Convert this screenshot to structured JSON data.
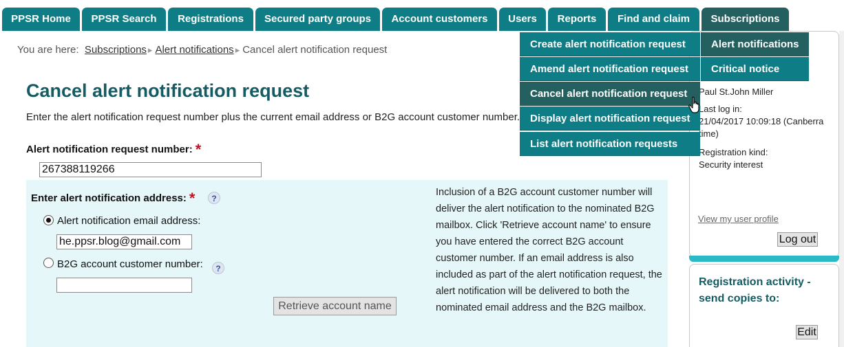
{
  "nav": {
    "tabs": [
      {
        "label": "PPSR Home"
      },
      {
        "label": "PPSR Search"
      },
      {
        "label": "Registrations"
      },
      {
        "label": "Secured party groups"
      },
      {
        "label": "Account customers"
      },
      {
        "label": "Users"
      },
      {
        "label": "Reports"
      },
      {
        "label": "Find and claim"
      },
      {
        "label": "Subscriptions",
        "active": true
      }
    ]
  },
  "breadcrumb": {
    "prefix": "You are here:",
    "items": [
      "Subscriptions",
      "Alert notifications"
    ],
    "current": "Cancel alert notification request"
  },
  "main": {
    "title": "Cancel alert notification request",
    "intro": "Enter the alert notification request number plus the current email address or B2G account customer number.",
    "request_number": {
      "label": "Alert notification request number:",
      "required_mark": "*",
      "value": "267388119266"
    },
    "address": {
      "label": "Enter alert notification address:",
      "required_mark": "*",
      "help": "?",
      "email_option": {
        "label": "Alert notification email address:",
        "selected": true,
        "value": "he.ppsr.blog@gmail.com"
      },
      "b2g_option": {
        "label": "B2G account customer number:",
        "selected": false,
        "value": "",
        "help": "?"
      },
      "retrieve_button": "Retrieve account name",
      "info": "Inclusion of a B2G account customer number will deliver the alert notification to the nominated B2G mailbox. Click 'Retrieve account name' to ensure you have entered the correct B2G account customer number. If an email address is also included as part of the alert notification request, the alert notification will be delivered to both the nominated email address and the B2G mailbox."
    }
  },
  "sidebar": {
    "user_name": "Paul St.John Miller",
    "last_login_label": "Last log in:",
    "last_login_value": "21/04/2017 10:09:18 (Canberra time)",
    "registration_kind_label": "Registration kind:",
    "registration_kind_value": "Security interest",
    "profile_link": "View my user profile",
    "logout_button": "Log out",
    "activity_heading": "Registration activity - send copies to:",
    "edit_button": "Edit"
  },
  "menus": {
    "subscriptions": [
      {
        "label": "Alert notifications",
        "selected": true
      },
      {
        "label": "Critical notice"
      }
    ],
    "alert_notifications": [
      {
        "label": "Create alert notification request"
      },
      {
        "label": "Amend alert notification request"
      },
      {
        "label": "Cancel alert notification request",
        "hovered": true
      },
      {
        "label": "Display alert notification request"
      },
      {
        "label": "List alert notification requests"
      }
    ]
  },
  "colors": {
    "nav_teal": "#0e7d85",
    "nav_active": "#24605f",
    "title": "#155b63",
    "panel_bg": "#e6f7f9",
    "required": "#c1121f"
  },
  "icons": {
    "cursor": "hand-pointer-icon",
    "help": "question-mark-icon",
    "breadcrumb_separator": "chevron-right-icon"
  }
}
